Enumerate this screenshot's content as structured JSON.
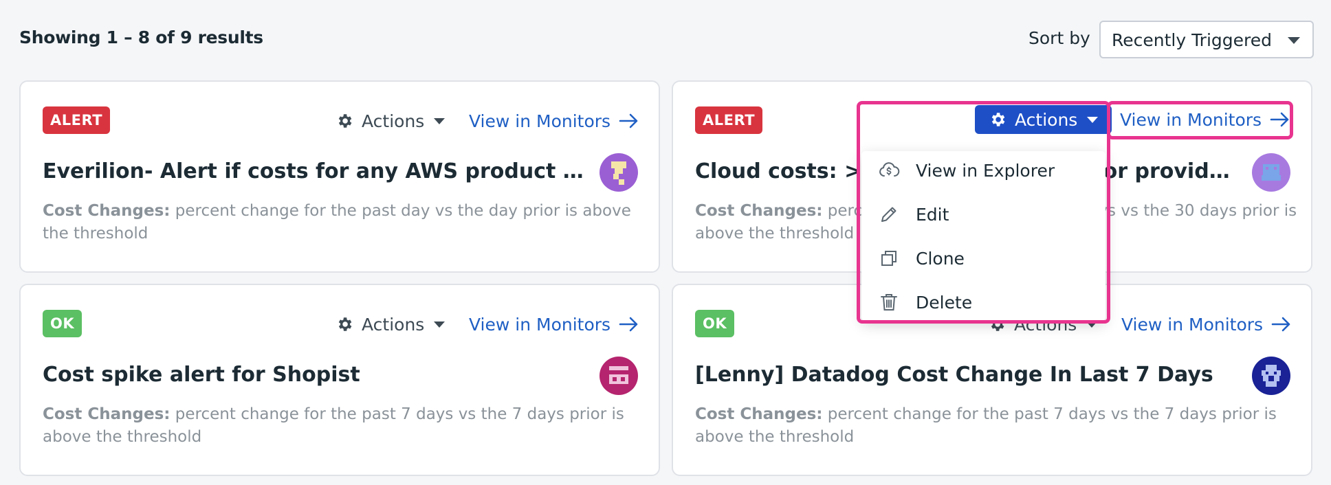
{
  "header": {
    "results_text": "Showing 1 – 8 of 9 results",
    "sort_label": "Sort by",
    "sort_value": "Recently Triggered"
  },
  "cards": [
    {
      "status": "ALERT",
      "actions_label": "Actions",
      "view_label": "View in Monitors",
      "title": "Everilion- Alert if costs for any AWS product increase by more than 20% day over day",
      "desc_label": "Cost Changes:",
      "desc_text": " percent change for the past day vs the day prior is above the threshold"
    },
    {
      "status": "ALERT",
      "actions_label": "Actions",
      "view_label": "View in Monitors",
      "title": "Cloud costs: >20% change in cost for provider {{provisio...",
      "desc_label": "Cost Changes:",
      "desc_text": " percent change for the past 30 days vs the 30 days prior is above the threshold"
    },
    {
      "status": "OK",
      "actions_label": "Actions",
      "view_label": "View in Monitors",
      "title": "Cost spike alert for Shopist",
      "desc_label": "Cost Changes:",
      "desc_text": " percent change for the past 7 days vs the 7 days prior is above the threshold"
    },
    {
      "status": "OK",
      "actions_label": "Actions",
      "view_label": "View in Monitors",
      "title": "[Lenny] Datadog Cost Change In Last 7 Days",
      "desc_label": "Cost Changes:",
      "desc_text": " percent change for the past 7 days vs the 7 days prior is above the threshold"
    }
  ],
  "actions_menu": {
    "items": [
      {
        "label": "View in Explorer",
        "icon": "cloud-dollar-icon"
      },
      {
        "label": "Edit",
        "icon": "pencil-icon"
      },
      {
        "label": "Clone",
        "icon": "clone-icon"
      },
      {
        "label": "Delete",
        "icon": "trash-icon"
      }
    ]
  },
  "colors": {
    "alert": "#d8343f",
    "ok": "#5bbf63",
    "link": "#1f5fc4",
    "primary_button": "#1e4fc7",
    "highlight": "#e8348f"
  }
}
